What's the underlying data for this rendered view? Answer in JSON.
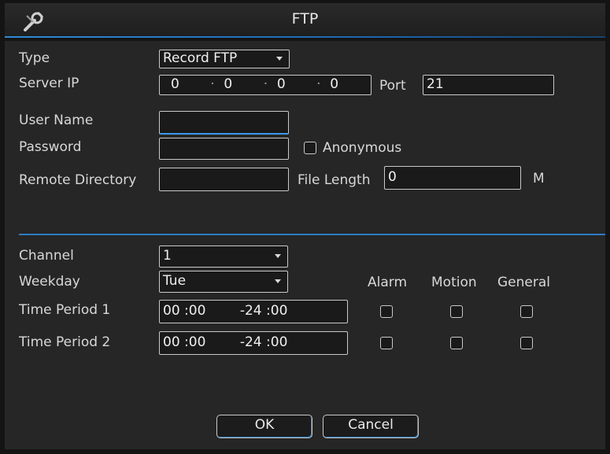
{
  "window": {
    "title": "FTP",
    "tool_icon": "wrench-screwdriver-icon"
  },
  "form": {
    "type_label": "Type",
    "type_value": "Record FTP",
    "server_ip_label": "Server IP",
    "ip": [
      "0",
      "0",
      "0",
      "0"
    ],
    "port_label": "Port",
    "port_value": "21",
    "user_name_label": "User Name",
    "user_name_value": "",
    "password_label": "Password",
    "password_value": "",
    "anonymous_label": "Anonymous",
    "remote_dir_label": "Remote Directory",
    "remote_dir_value": "",
    "file_length_label": "File Length",
    "file_length_value": "0",
    "file_length_unit": "M"
  },
  "schedule": {
    "channel_label": "Channel",
    "channel_value": "1",
    "weekday_label": "Weekday",
    "weekday_value": "Tue",
    "col_alarm": "Alarm",
    "col_motion": "Motion",
    "col_general": "General",
    "periods": [
      {
        "label": "Time Period 1",
        "start_h": "00",
        "start_m": "00",
        "end_h": "24",
        "end_m": "00"
      },
      {
        "label": "Time Period 2",
        "start_h": "00",
        "start_m": "00",
        "end_h": "24",
        "end_m": "00"
      }
    ]
  },
  "buttons": {
    "ok": "OK",
    "cancel": "Cancel"
  },
  "colors": {
    "accent": "#2e7cc4",
    "background": "#262626",
    "title_bar": "#1e1e1e"
  }
}
